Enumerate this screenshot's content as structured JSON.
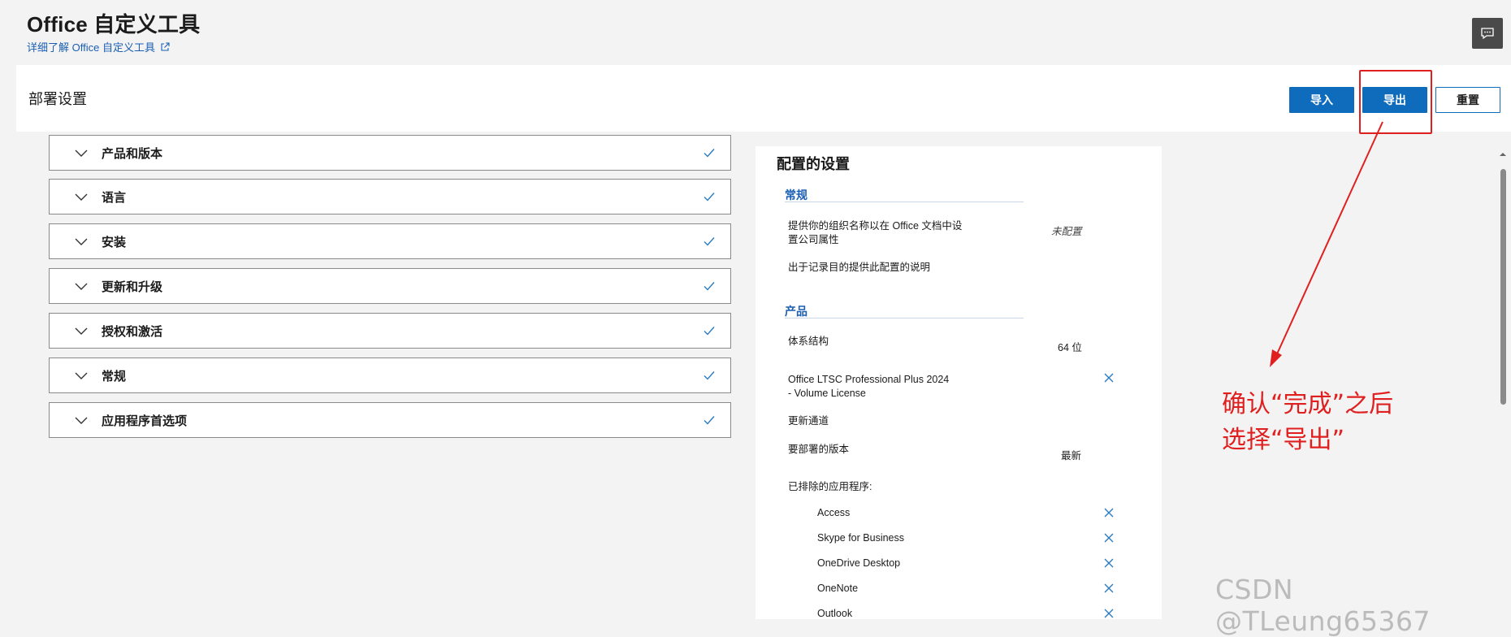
{
  "app": {
    "title": "Office 自定义工具",
    "learn_more": "详细了解 Office 自定义工具",
    "feedback_icon": "feedback-icon"
  },
  "toolbar": {
    "section_title": "部署设置",
    "import_label": "导入",
    "export_label": "导出",
    "reset_label": "重置"
  },
  "accordion": [
    {
      "label": "产品和版本"
    },
    {
      "label": "语言"
    },
    {
      "label": "安装"
    },
    {
      "label": "更新和升级"
    },
    {
      "label": "授权和激活"
    },
    {
      "label": "常规"
    },
    {
      "label": "应用程序首选项"
    }
  ],
  "settings": {
    "title": "配置的设置",
    "general": {
      "heading": "常规",
      "org_label": "提供你的组织名称以在 Office 文档中设置公司属性",
      "org_value": "未配置",
      "desc_label": "出于记录目的提供此配置的说明"
    },
    "products": {
      "heading": "产品",
      "arch_label": "体系结构",
      "arch_value": "64 位",
      "product_name": "Office LTSC Professional Plus 2024 - Volume License",
      "channel_label": "更新通道",
      "version_label": "要部署的版本",
      "version_value": "最新",
      "excluded_label": "已排除的应用程序:",
      "excluded_apps": [
        "Access",
        "Skype for Business",
        "OneDrive Desktop",
        "OneNote",
        "Outlook"
      ]
    }
  },
  "annotation": {
    "text": "确认“完成”之后\n选择“导出”",
    "color": "#e02020"
  },
  "watermark": "CSDN @TLeung65367",
  "colors": {
    "accent": "#0f6cbd",
    "link": "#1a5fb4"
  }
}
